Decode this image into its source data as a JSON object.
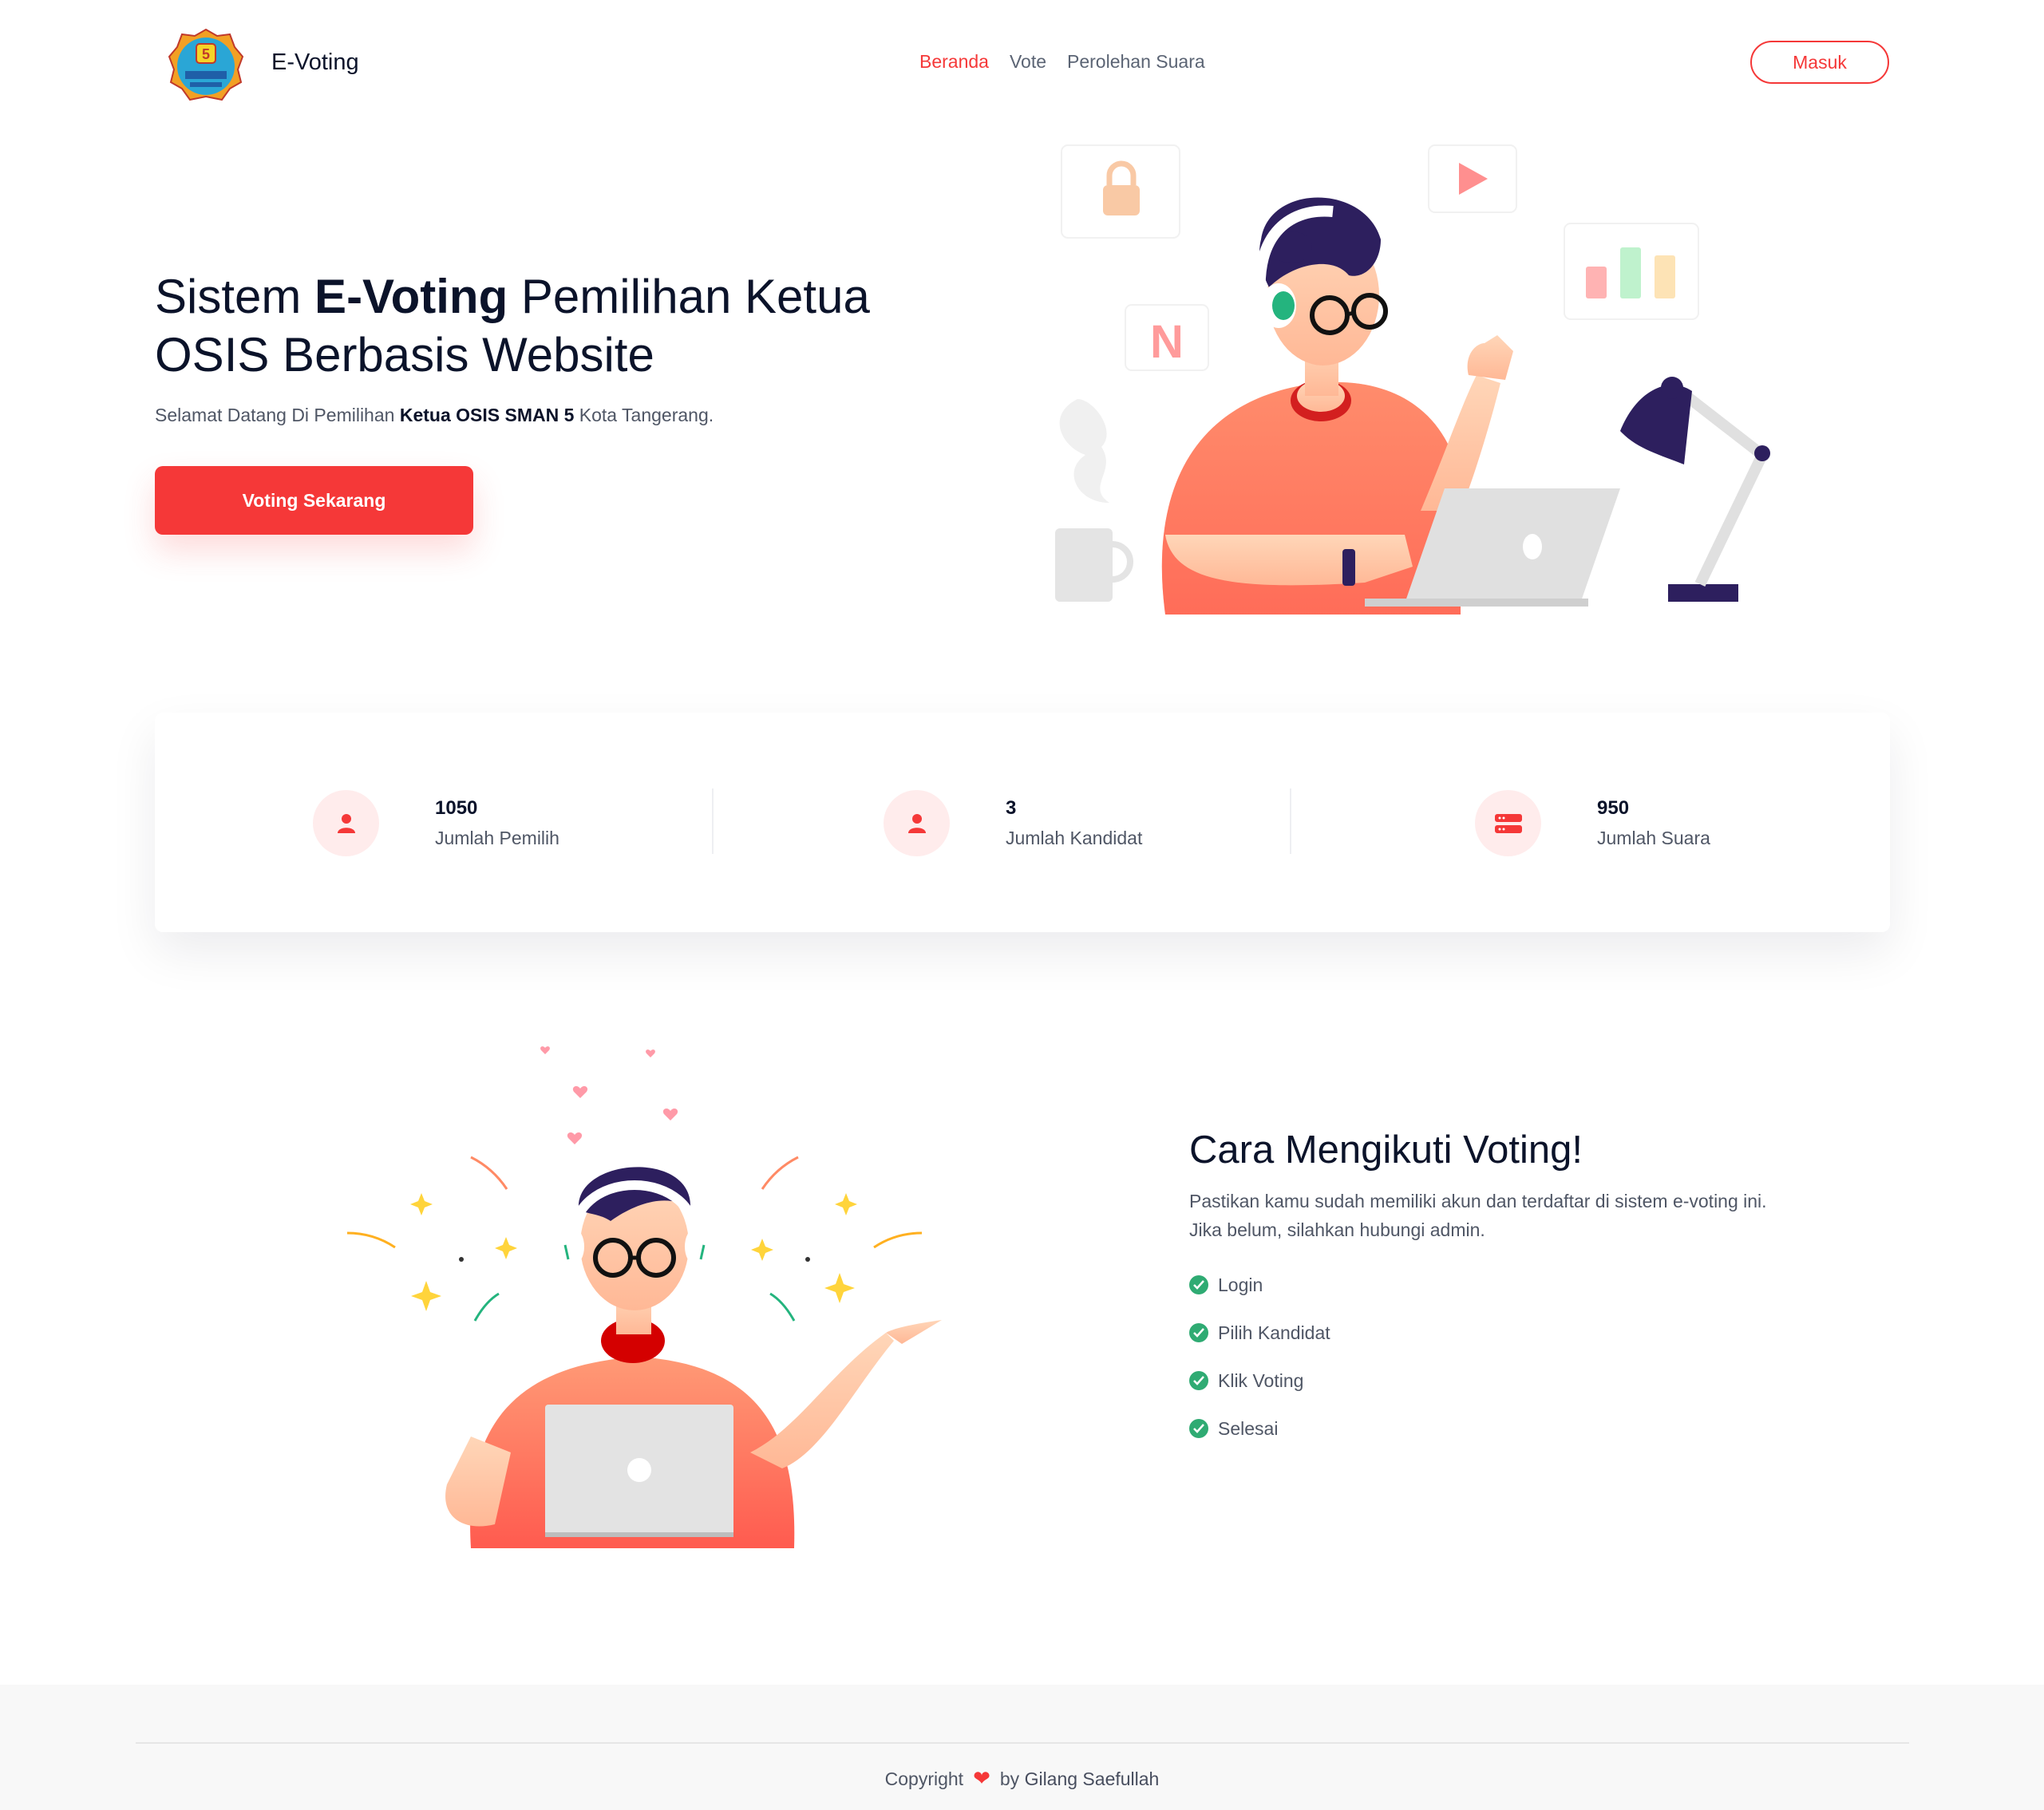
{
  "header": {
    "brand": "E-Voting",
    "logo_icon": "school-emblem-icon",
    "nav": [
      "Beranda",
      "Vote",
      "Perolehan Suara"
    ],
    "active_nav": "Beranda",
    "login_label": "Masuk"
  },
  "hero": {
    "title_prefix": "Sistem ",
    "title_bold": "E-Voting",
    "title_suffix": " Pemilihan Ketua OSIS Berbasis Website",
    "subtitle_prefix": "Selamat Datang Di Pemilihan ",
    "subtitle_bold": "Ketua OSIS SMAN 5",
    "subtitle_suffix": " Kota Tangerang.",
    "cta_label": "Voting Sekarang",
    "illustration_letter": "N"
  },
  "stats": [
    {
      "icon": "user-icon",
      "value": "1050",
      "label": "Jumlah Pemilih"
    },
    {
      "icon": "user-icon",
      "value": "3",
      "label": "Jumlah Kandidat"
    },
    {
      "icon": "server-icon",
      "value": "950",
      "label": "Jumlah Suara"
    }
  ],
  "how_to": {
    "title": "Cara Mengikuti Voting!",
    "desc_line1": "Pastikan kamu sudah memiliki akun dan terdaftar di sistem e-voting ini.",
    "desc_line2": "Jika belum, silahkan hubungi admin.",
    "steps": [
      "Login",
      "Pilih Kandidat",
      "Klik Voting",
      "Selesai"
    ]
  },
  "footer": {
    "prefix": "Copyright",
    "suffix": "by",
    "author": "Gilang Saefullah"
  },
  "colors": {
    "accent": "#f53838",
    "dark": "#0b132a",
    "check": "#2fab73",
    "stat_bg": "#ffecec"
  }
}
